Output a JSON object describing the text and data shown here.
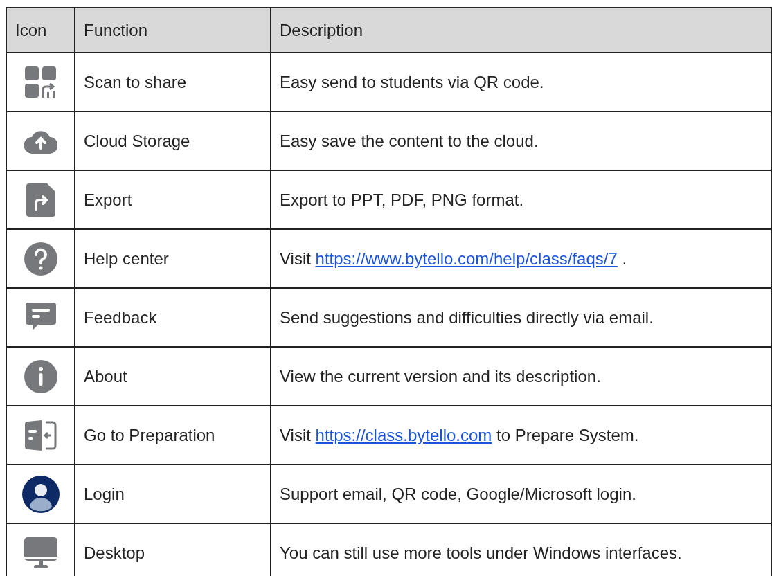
{
  "table": {
    "columns": [
      "Icon",
      "Function",
      "Description"
    ],
    "rows": [
      {
        "function": "Scan to share",
        "description": [
          {
            "kind": "text",
            "text": "Easy send to students via QR code."
          }
        ]
      },
      {
        "function": "Cloud Storage",
        "description": [
          {
            "kind": "text",
            "text": "Easy save the content to the cloud."
          }
        ]
      },
      {
        "function": "Export",
        "description": [
          {
            "kind": "text",
            "text": "Export to PPT, PDF, PNG format."
          }
        ]
      },
      {
        "function": "Help center",
        "description": [
          {
            "kind": "text",
            "text": "Visit "
          },
          {
            "kind": "link",
            "text": "https://www.bytello.com/help/class/faqs/7"
          },
          {
            "kind": "text",
            "text": " ."
          }
        ]
      },
      {
        "function": "Feedback",
        "description": [
          {
            "kind": "text",
            "text": "Send suggestions and difficulties directly via email."
          }
        ]
      },
      {
        "function": "About",
        "description": [
          {
            "kind": "text",
            "text": "View the current version and its description."
          }
        ]
      },
      {
        "function": "Go to Preparation",
        "description": [
          {
            "kind": "text",
            "text": "Visit "
          },
          {
            "kind": "link",
            "text": "https://class.bytello.com"
          },
          {
            "kind": "text",
            "text": " to Prepare System."
          }
        ]
      },
      {
        "function": "Login",
        "description": [
          {
            "kind": "text",
            "text": "Support email, QR code, Google/Microsoft login."
          }
        ]
      },
      {
        "function": "Desktop",
        "description": [
          {
            "kind": "text",
            "text": "You can still use more tools under Windows interfaces."
          }
        ]
      }
    ]
  }
}
